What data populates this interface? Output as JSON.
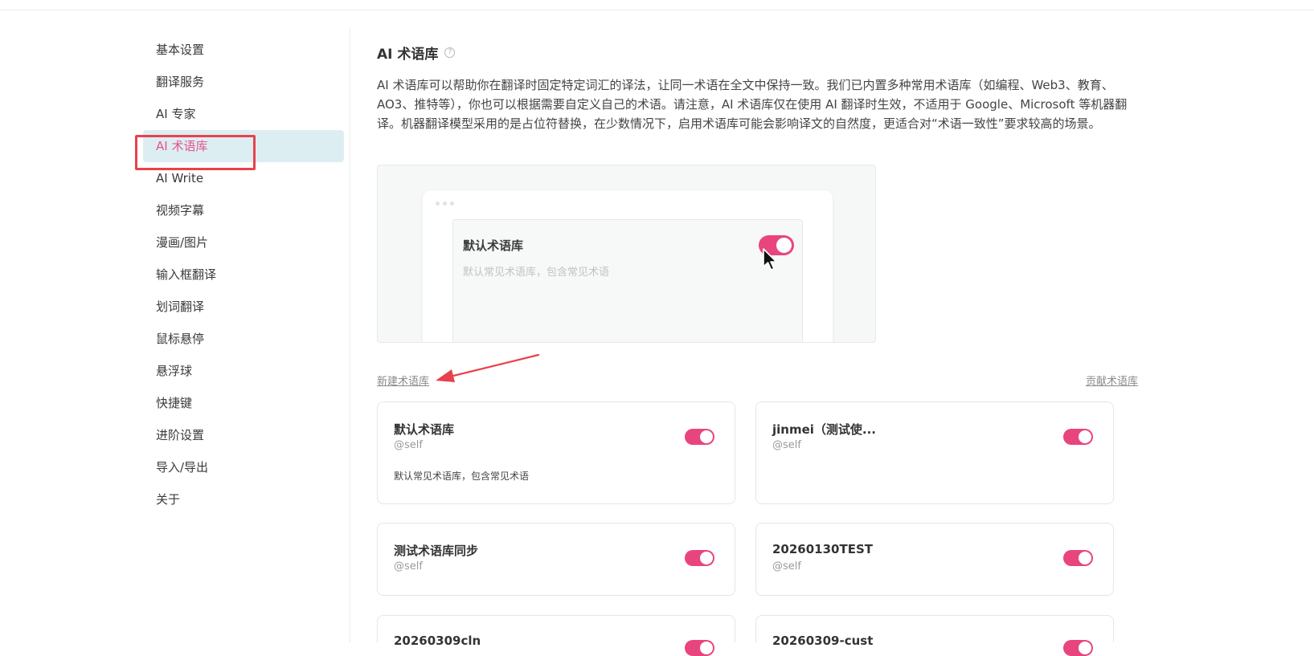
{
  "sidebar": {
    "items": [
      {
        "label": "基本设置"
      },
      {
        "label": "翻译服务"
      },
      {
        "label": "AI 专家"
      },
      {
        "label": "AI 术语库"
      },
      {
        "label": "AI Write"
      },
      {
        "label": "视频字幕"
      },
      {
        "label": "漫画/图片"
      },
      {
        "label": "输入框翻译"
      },
      {
        "label": "划词翻译"
      },
      {
        "label": "鼠标悬停"
      },
      {
        "label": "悬浮球"
      },
      {
        "label": "快捷键"
      },
      {
        "label": "进阶设置"
      },
      {
        "label": "导入/导出"
      },
      {
        "label": "关于"
      }
    ],
    "active_index": 3
  },
  "main": {
    "title": "AI 术语库",
    "help_icon": "?",
    "description": "AI 术语库可以帮助你在翻译时固定特定词汇的译法，让同一术语在全文中保持一致。我们已内置多种常用术语库（如编程、Web3、教育、AO3、推特等），你也可以根据需要自定义自己的术语。请注意，AI 术语库仅在使用 AI 翻译时生效，不适用于 Google、Microsoft 等机器翻译。机器翻译模型采用的是占位符替换，在少数情况下，启用术语库可能会影响译文的自然度，更适合对“术语一致性”要求较高的场景。"
  },
  "preview": {
    "card_title": "默认术语库",
    "card_desc": "默认常见术语库，包含常见术语",
    "toggle_on": true
  },
  "links": {
    "new_glossary": "新建术语库",
    "contribute_glossary": "贡献术语库"
  },
  "cards": [
    {
      "name": "默认术语库",
      "owner": "@self",
      "desc": "默认常见术语库，包含常见术语",
      "enabled": true
    },
    {
      "name": "jinmei（测试使...",
      "owner": "@self",
      "desc": "",
      "enabled": true
    },
    {
      "name": "测试术语库同步",
      "owner": "@self",
      "desc": "",
      "enabled": true
    },
    {
      "name": "20260130TEST",
      "owner": "@self",
      "desc": "",
      "enabled": true
    },
    {
      "name": "20260309cln",
      "owner": "",
      "desc": "",
      "enabled": true
    },
    {
      "name": "20260309-cust",
      "owner": "",
      "desc": "",
      "enabled": true
    }
  ],
  "colors": {
    "accent": "#e8457f",
    "active_bg": "#ddeef3",
    "highlight_border": "#e8424c"
  }
}
